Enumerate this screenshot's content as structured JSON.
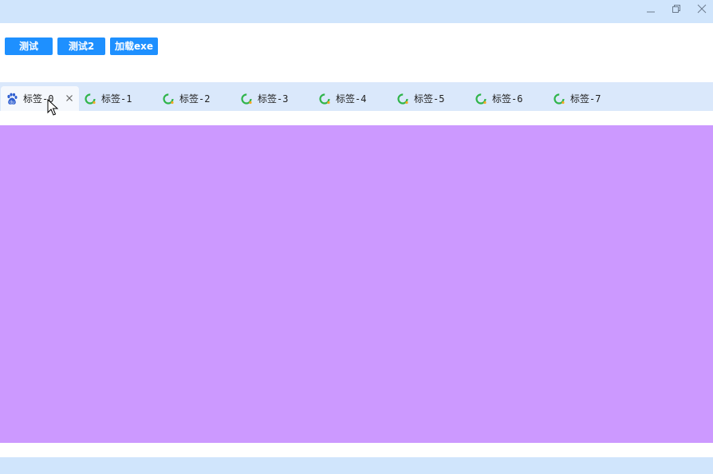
{
  "window_controls": {
    "minimize": "minimize-icon",
    "restore": "restore-icon",
    "close": "close-icon"
  },
  "toolbar": {
    "buttons": [
      {
        "label": "测试"
      },
      {
        "label": "测试2"
      },
      {
        "label": "加载exe"
      }
    ]
  },
  "tabs": {
    "items": [
      {
        "label": "标签-0",
        "icon": "baidu-paw-icon",
        "active": true
      },
      {
        "label": "标签-1",
        "icon": "loading-ring-icon"
      },
      {
        "label": "标签-2",
        "icon": "loading-ring-icon"
      },
      {
        "label": "标签-3",
        "icon": "loading-ring-icon"
      },
      {
        "label": "标签-4",
        "icon": "loading-ring-icon"
      },
      {
        "label": "标签-5",
        "icon": "loading-ring-icon"
      },
      {
        "label": "标签-6",
        "icon": "loading-ring-icon"
      },
      {
        "label": "标签-7",
        "icon": "loading-ring-icon"
      }
    ],
    "close_icon": "close-icon"
  },
  "colors": {
    "titlebar": "#d0e5fc",
    "button": "#1e90ff",
    "tabbar": "#dae8fb",
    "content": "#cc99ff"
  }
}
